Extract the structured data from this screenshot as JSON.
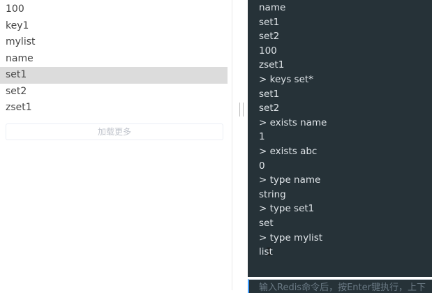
{
  "key_list": {
    "items": [
      "100",
      "key1",
      "mylist",
      "name",
      "set1",
      "set2",
      "zset1"
    ],
    "selected": "set1",
    "load_more_label": "加载更多"
  },
  "console": {
    "lines": [
      "name",
      "set1",
      "set2",
      "100",
      "zset1",
      "> keys set*",
      "set1",
      "set2",
      "> exists name",
      "1",
      "> exists abc",
      "0",
      "> type  name",
      "string",
      "> type set1",
      "set",
      "> type mylist",
      "list"
    ],
    "input_placeholder": "输入Redis命令后，按Enter键执行，上下",
    "background_color": "#263238",
    "accent_color": "#409eff"
  }
}
